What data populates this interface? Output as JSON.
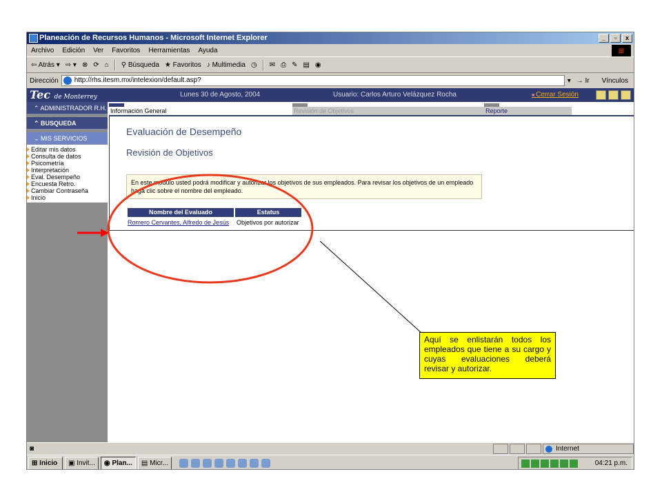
{
  "window": {
    "title": "Planeación de Recursos Humanos - Microsoft Internet Explorer",
    "min": "_",
    "max": "▫",
    "close": "x"
  },
  "menu": [
    "Archivo",
    "Edición",
    "Ver",
    "Favoritos",
    "Herramientas",
    "Ayuda"
  ],
  "toolbar": {
    "back": "⇦ Atrás ▾",
    "forward": "⇨ ▾",
    "search": "Búsqueda",
    "favorites": "Favoritos",
    "multimedia": "Multimedia"
  },
  "address": {
    "label": "Dirección",
    "url": "http://rhs.itesm.mx/intelexion/default.asp?",
    "go": "Ir",
    "links": "Vínculos"
  },
  "header": {
    "logo_main": "Tec",
    "logo_sub": "de Monterrey",
    "date": "Lunes 30 de Agosto, 2004",
    "user": "Usuario: Carlos Arturo Velázquez Rocha",
    "logout": "Cerrar Sesión"
  },
  "sidebar": {
    "buttons": [
      "ADMINISTRADOR R.H.",
      "BUSQUEDA",
      "MIS SERVICIOS"
    ],
    "items": [
      "Editar mis datos",
      "Consulta de datos",
      "Psicometría",
      "Interpretación",
      "Eval. Desempeño",
      "Encuesta Retro.",
      "Cambiar Contraseña",
      "Inicio"
    ]
  },
  "tabs": [
    "Información General",
    "Revisión de Objetivos",
    "Reporte"
  ],
  "main": {
    "title": "Evaluación de Desempeño",
    "subtitle": "Revisión de Objetivos",
    "info": "En este modulo usted podrá modificar y autorizar los objetivos de sus empleados. Para revisar los objetivos de un empleado haga clic sobre el nombre del empleado.",
    "table": {
      "headers": [
        "Nombre del Evaluado",
        "Estatus"
      ],
      "rows": [
        {
          "name": "Romero Cervantes, Alfredo de Jesús",
          "status": "Objetivos por autorizar"
        }
      ]
    }
  },
  "statusbar": {
    "zone": "Internet"
  },
  "taskbar": {
    "start": "Inicio",
    "items": [
      "Invit...",
      "Plan...",
      "Micr..."
    ],
    "clock": "04:21 p.m."
  },
  "annotation": {
    "text": "Aquí se enlistarán todos los empleados que tiene a su cargo y cuyas evaluaciones deberá revisar y autorizar.",
    "arrow_color": "#ff0000",
    "ellipse_color": "#e8391c",
    "callout_bg": "#ffff00"
  }
}
